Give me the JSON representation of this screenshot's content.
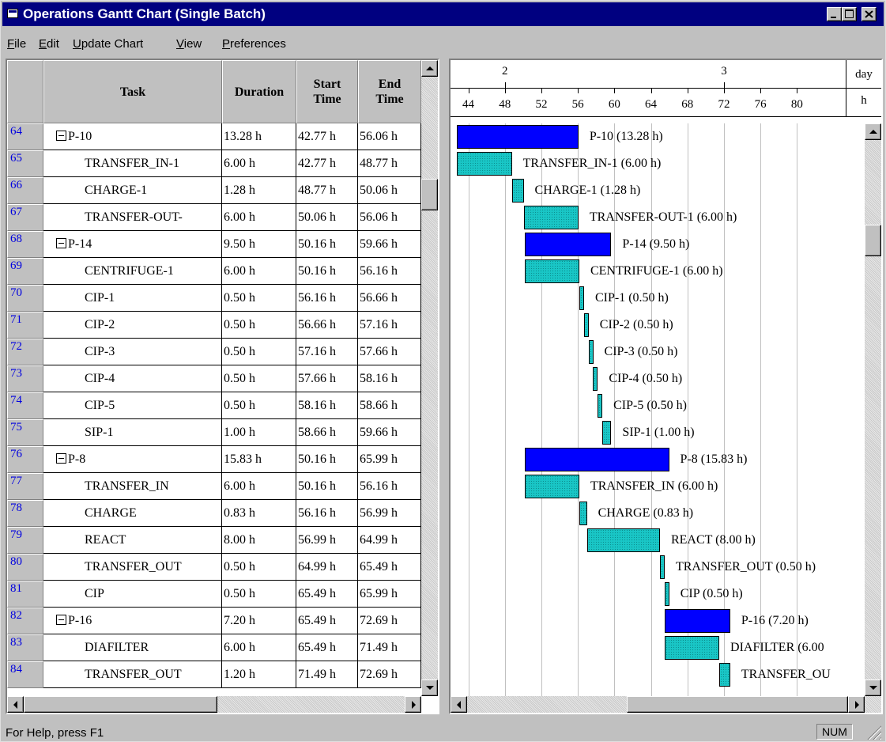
{
  "window": {
    "title": "Operations Gantt Chart (Single Batch)",
    "controls": [
      "minimize-icon",
      "maximize-icon",
      "close-icon"
    ]
  },
  "menu": [
    {
      "label": "File",
      "hotkey": "F"
    },
    {
      "label": "Edit",
      "hotkey": "E"
    },
    {
      "label": "Update Chart",
      "hotkey": "U"
    },
    {
      "label": "View",
      "hotkey": "V"
    },
    {
      "label": "Preferences",
      "hotkey": "P"
    }
  ],
  "table": {
    "headers": {
      "task": "Task",
      "duration": "Duration",
      "start_1": "Start",
      "start_2": "Time",
      "end_1": "End",
      "end_2": "Time"
    },
    "rows": [
      {
        "num": "64",
        "task": "P-10",
        "group": true,
        "duration": "13.28 h",
        "start": "42.77 h",
        "end": "56.06 h"
      },
      {
        "num": "65",
        "task": "TRANSFER_IN-1",
        "group": false,
        "duration": "6.00 h",
        "start": "42.77 h",
        "end": "48.77 h"
      },
      {
        "num": "66",
        "task": "CHARGE-1",
        "group": false,
        "duration": "1.28 h",
        "start": "48.77 h",
        "end": "50.06 h"
      },
      {
        "num": "67",
        "task": "TRANSFER-OUT-",
        "group": false,
        "duration": "6.00 h",
        "start": "50.06 h",
        "end": "56.06 h"
      },
      {
        "num": "68",
        "task": "P-14",
        "group": true,
        "duration": "9.50 h",
        "start": "50.16 h",
        "end": "59.66 h"
      },
      {
        "num": "69",
        "task": "CENTRIFUGE-1",
        "group": false,
        "duration": "6.00 h",
        "start": "50.16 h",
        "end": "56.16 h"
      },
      {
        "num": "70",
        "task": "CIP-1",
        "group": false,
        "duration": "0.50 h",
        "start": "56.16 h",
        "end": "56.66 h"
      },
      {
        "num": "71",
        "task": "CIP-2",
        "group": false,
        "duration": "0.50 h",
        "start": "56.66 h",
        "end": "57.16 h"
      },
      {
        "num": "72",
        "task": "CIP-3",
        "group": false,
        "duration": "0.50 h",
        "start": "57.16 h",
        "end": "57.66 h"
      },
      {
        "num": "73",
        "task": "CIP-4",
        "group": false,
        "duration": "0.50 h",
        "start": "57.66 h",
        "end": "58.16 h"
      },
      {
        "num": "74",
        "task": "CIP-5",
        "group": false,
        "duration": "0.50 h",
        "start": "58.16 h",
        "end": "58.66 h"
      },
      {
        "num": "75",
        "task": "SIP-1",
        "group": false,
        "duration": "1.00 h",
        "start": "58.66 h",
        "end": "59.66 h"
      },
      {
        "num": "76",
        "task": "P-8",
        "group": true,
        "duration": "15.83 h",
        "start": "50.16 h",
        "end": "65.99 h"
      },
      {
        "num": "77",
        "task": "TRANSFER_IN",
        "group": false,
        "duration": "6.00 h",
        "start": "50.16 h",
        "end": "56.16 h"
      },
      {
        "num": "78",
        "task": "CHARGE",
        "group": false,
        "duration": "0.83 h",
        "start": "56.16 h",
        "end": "56.99 h"
      },
      {
        "num": "79",
        "task": "REACT",
        "group": false,
        "duration": "8.00 h",
        "start": "56.99 h",
        "end": "64.99 h"
      },
      {
        "num": "80",
        "task": "TRANSFER_OUT",
        "group": false,
        "duration": "0.50 h",
        "start": "64.99 h",
        "end": "65.49 h"
      },
      {
        "num": "81",
        "task": "CIP",
        "group": false,
        "duration": "0.50 h",
        "start": "65.49 h",
        "end": "65.99 h"
      },
      {
        "num": "82",
        "task": "P-16",
        "group": true,
        "duration": "7.20 h",
        "start": "65.49 h",
        "end": "72.69 h"
      },
      {
        "num": "83",
        "task": "DIAFILTER",
        "group": false,
        "duration": "6.00 h",
        "start": "65.49 h",
        "end": "71.49 h"
      },
      {
        "num": "84",
        "task": "TRANSFER_OUT",
        "group": false,
        "duration": "1.20 h",
        "start": "71.49 h",
        "end": "72.69 h"
      }
    ]
  },
  "gantt": {
    "day_ticks": [
      {
        "label": "2",
        "hour": 48
      },
      {
        "label": "3",
        "hour": 72
      }
    ],
    "hour_ticks": [
      44,
      48,
      52,
      56,
      60,
      64,
      68,
      72,
      76,
      80
    ],
    "unit_day": "day",
    "unit_hour": "h",
    "bar_labels": [
      "P-10 (13.28 h)",
      "TRANSFER_IN-1 (6.00 h)",
      "CHARGE-1 (1.28 h)",
      "TRANSFER-OUT-1 (6.00 h)",
      "P-14 (9.50 h)",
      "CENTRIFUGE-1 (6.00 h)",
      "CIP-1 (0.50 h)",
      "CIP-2 (0.50 h)",
      "CIP-3 (0.50 h)",
      "CIP-4 (0.50 h)",
      "CIP-5 (0.50 h)",
      "SIP-1 (1.00 h)",
      "P-8 (15.83 h)",
      "TRANSFER_IN (6.00 h)",
      "CHARGE (0.83 h)",
      "REACT (8.00 h)",
      "TRANSFER_OUT (0.50 h)",
      "CIP (0.50 h)",
      "P-16 (7.20 h)",
      "DIAFILTER (6.00",
      "TRANSFER_OU"
    ],
    "colors": {
      "summary": "#0000ff",
      "task": "#19c6c6",
      "gridline": "#c0c0c0"
    }
  },
  "status": {
    "text": "For Help, press F1",
    "num": "NUM"
  }
}
